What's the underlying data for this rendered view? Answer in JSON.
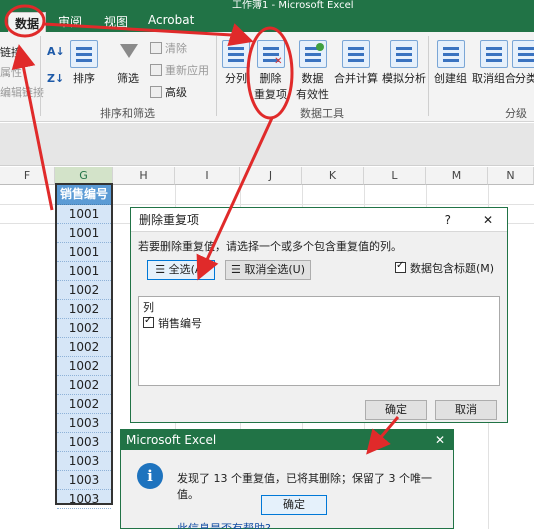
{
  "window": {
    "title": "工作簿1 - Microsoft Excel"
  },
  "tabs": [
    {
      "label": "数据",
      "active": true
    },
    {
      "label": "审阅"
    },
    {
      "label": "视图"
    },
    {
      "label": "Acrobat"
    }
  ],
  "ribbon": {
    "left_stub": [
      "链接",
      "属性",
      "编辑链接"
    ],
    "sort_az": "A↓Z",
    "sort": "排序",
    "filter": "筛选",
    "clear": "清除",
    "reapply": "重新应用",
    "advanced": "高级",
    "split": "分列",
    "remove_dup_line1": "删除",
    "remove_dup_line2": "重复项",
    "validation": "数据",
    "validation2": "有效性",
    "consolidate": "合并计算",
    "whatif": "模拟分析",
    "group": "创建组",
    "ungroup": "取消组合",
    "subtotal": "分类",
    "group_sort": "排序和筛选",
    "group_tools": "数据工具",
    "group_outline": "分级显"
  },
  "columns": [
    "F",
    "G",
    "H",
    "I",
    "J",
    "K",
    "L",
    "M",
    "N"
  ],
  "sheet": {
    "header": "销售编号",
    "values": [
      "1001",
      "1001",
      "1001",
      "1001",
      "1002",
      "1002",
      "1002",
      "1002",
      "1002",
      "1002",
      "1002",
      "1003",
      "1003",
      "1003",
      "1003",
      "1003"
    ]
  },
  "dialog_remove": {
    "title": "删除重复项",
    "help": "?",
    "close": "✕",
    "prompt": "若要删除重复值，请选择一个或多个包含重复值的列。",
    "select_all": "全选(A)",
    "unselect_all": "取消全选(U)",
    "has_headers": "数据包含标题(M)",
    "list_header": "列",
    "list_item": "销售编号",
    "ok": "确定",
    "cancel": "取消"
  },
  "dialog_msg": {
    "title": "Microsoft Excel",
    "close": "✕",
    "icon": "i",
    "message": "发现了 13 个重复值，已将其删除；保留了 3 个唯一值。",
    "ok": "确定",
    "help": "此信息是否有帮助?"
  },
  "colors": {
    "excel_green": "#217346",
    "arrow_red": "#e02a2a",
    "header_blue": "#5b9bd5"
  }
}
